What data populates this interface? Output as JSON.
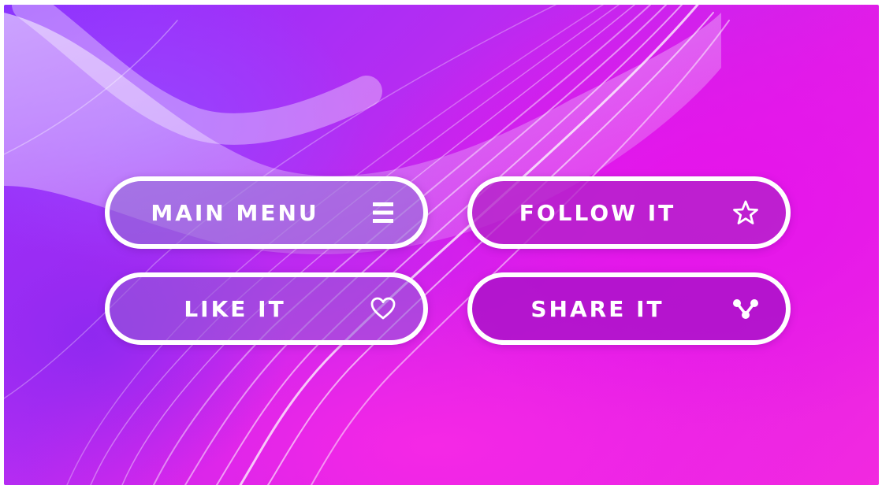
{
  "buttons": {
    "main_menu": {
      "label": "MAIN MENU",
      "icon": "menu-icon"
    },
    "follow_it": {
      "label": "FOLLOW IT",
      "icon": "star-icon"
    },
    "like_it": {
      "label": "LIKE IT",
      "icon": "heart-icon"
    },
    "share_it": {
      "label": "SHARE IT",
      "icon": "share-icon"
    }
  },
  "colors": {
    "background_primary": "#e01de8",
    "background_secondary": "#8a33ff",
    "button_outline": "#ffffff",
    "button_text": "#ffffff"
  }
}
